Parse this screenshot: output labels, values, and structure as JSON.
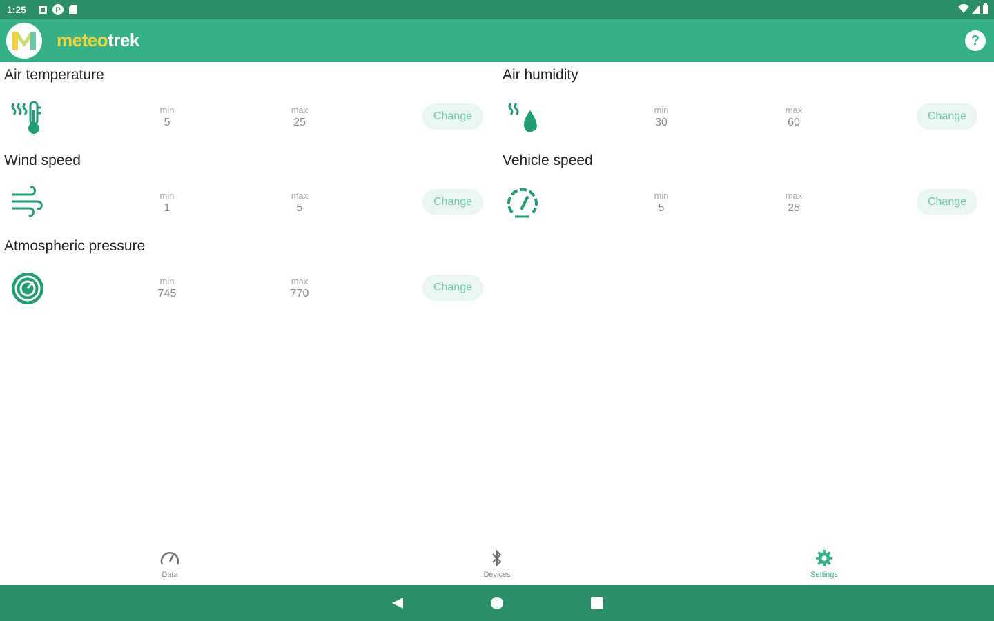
{
  "status": {
    "time": "1:25"
  },
  "app": {
    "brand_part1": "meteo",
    "brand_part2": "trek",
    "help_symbol": "?"
  },
  "cards": [
    {
      "title": "Air temperature",
      "icon": "thermometer-icon",
      "min_label": "min",
      "min": "5",
      "max_label": "max",
      "max": "25",
      "button": "Change"
    },
    {
      "title": "Air humidity",
      "icon": "humidity-drop-icon",
      "min_label": "min",
      "min": "30",
      "max_label": "max",
      "max": "60",
      "button": "Change"
    },
    {
      "title": "Wind speed",
      "icon": "wind-icon",
      "min_label": "min",
      "min": "1",
      "max_label": "max",
      "max": "5",
      "button": "Change"
    },
    {
      "title": "Vehicle speed",
      "icon": "speedometer-icon",
      "min_label": "min",
      "min": "5",
      "max_label": "max",
      "max": "25",
      "button": "Change"
    },
    {
      "title": "Atmospheric pressure",
      "icon": "barometer-icon",
      "min_label": "min",
      "min": "745",
      "max_label": "max",
      "max": "770",
      "button": "Change"
    }
  ],
  "nav": [
    {
      "label": "Data",
      "icon": "gauge-icon"
    },
    {
      "label": "Devices",
      "icon": "bluetooth-icon"
    },
    {
      "label": "Settings",
      "icon": "gear-icon"
    }
  ],
  "colors": {
    "primary": "#34b286",
    "status": "#2a8f69",
    "brand_accent": "#f3d43b"
  }
}
